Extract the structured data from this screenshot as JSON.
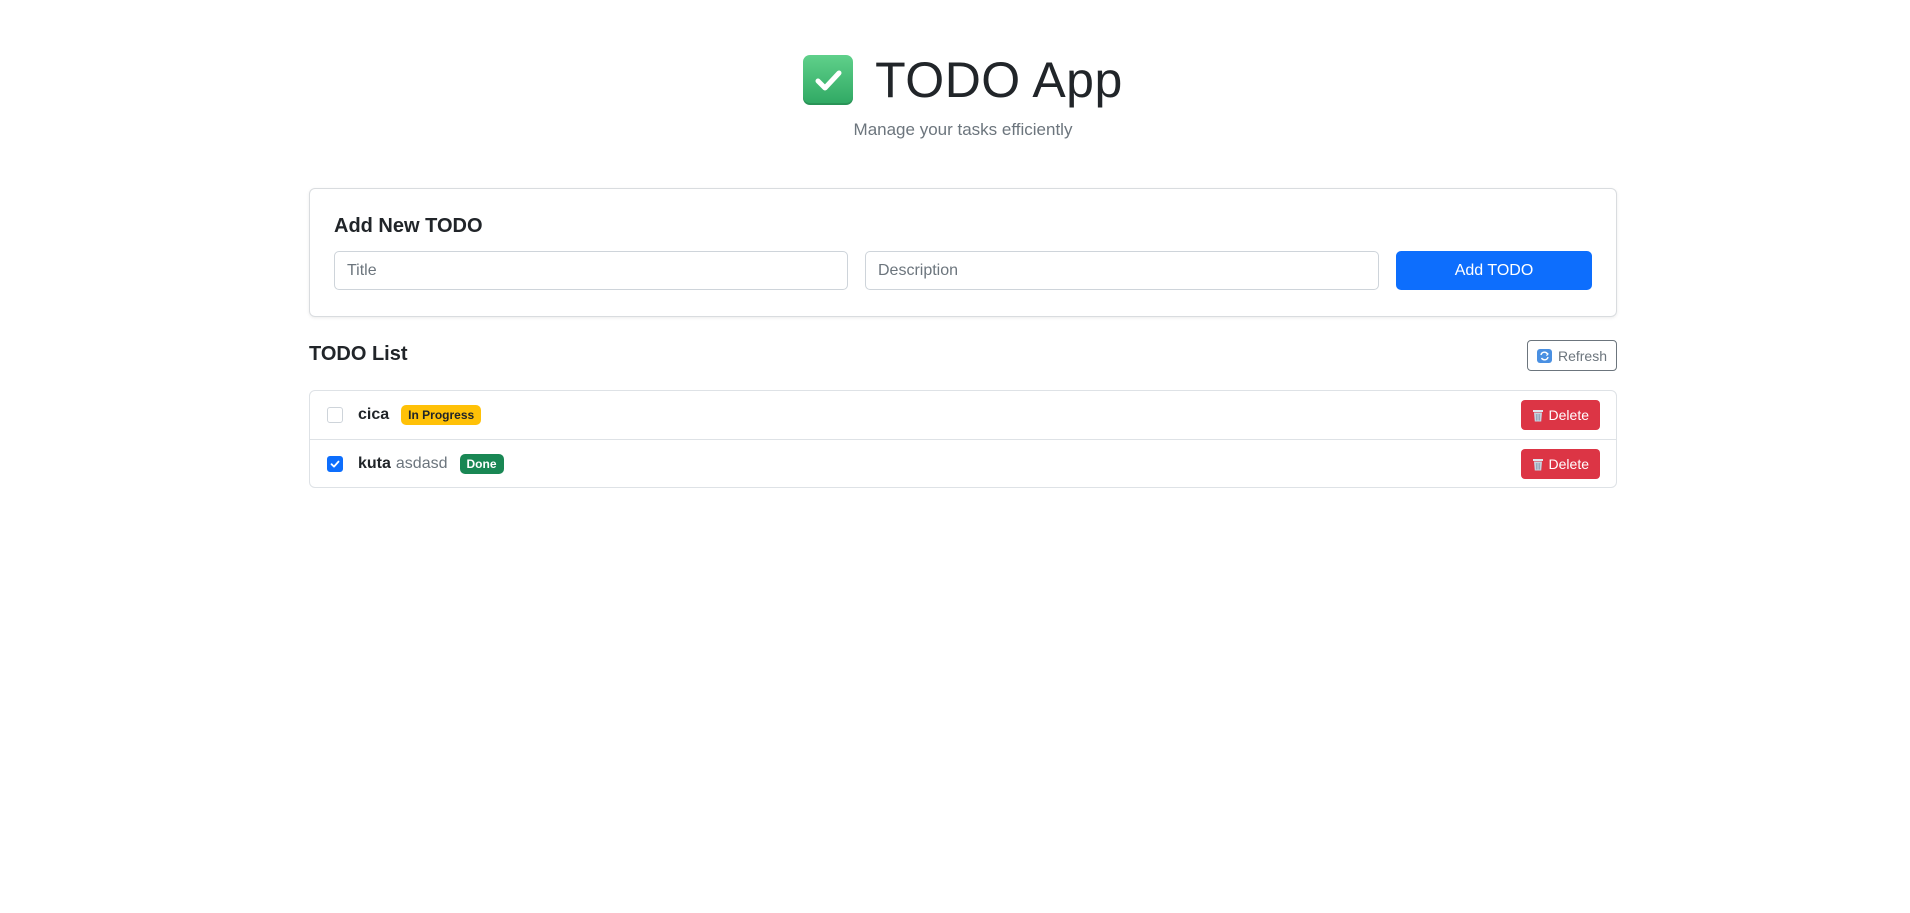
{
  "header": {
    "title": "TODO App",
    "subtitle": "Manage your tasks efficiently",
    "icon": "check-mark-button-icon"
  },
  "add_form": {
    "heading": "Add New TODO",
    "title_placeholder": "Title",
    "title_value": "",
    "description_placeholder": "Description",
    "description_value": "",
    "submit_label": "Add TODO"
  },
  "list": {
    "heading": "TODO List",
    "refresh_label": "Refresh",
    "items": [
      {
        "title": "cica",
        "description": "",
        "status": "In Progress",
        "done": false,
        "delete_label": "Delete"
      },
      {
        "title": "kuta",
        "description": "asdasd",
        "status": "Done",
        "done": true,
        "delete_label": "Delete"
      }
    ]
  },
  "colors": {
    "primary": "#0d6efd",
    "danger": "#dc3545",
    "warning": "#ffc107",
    "success": "#198754"
  }
}
